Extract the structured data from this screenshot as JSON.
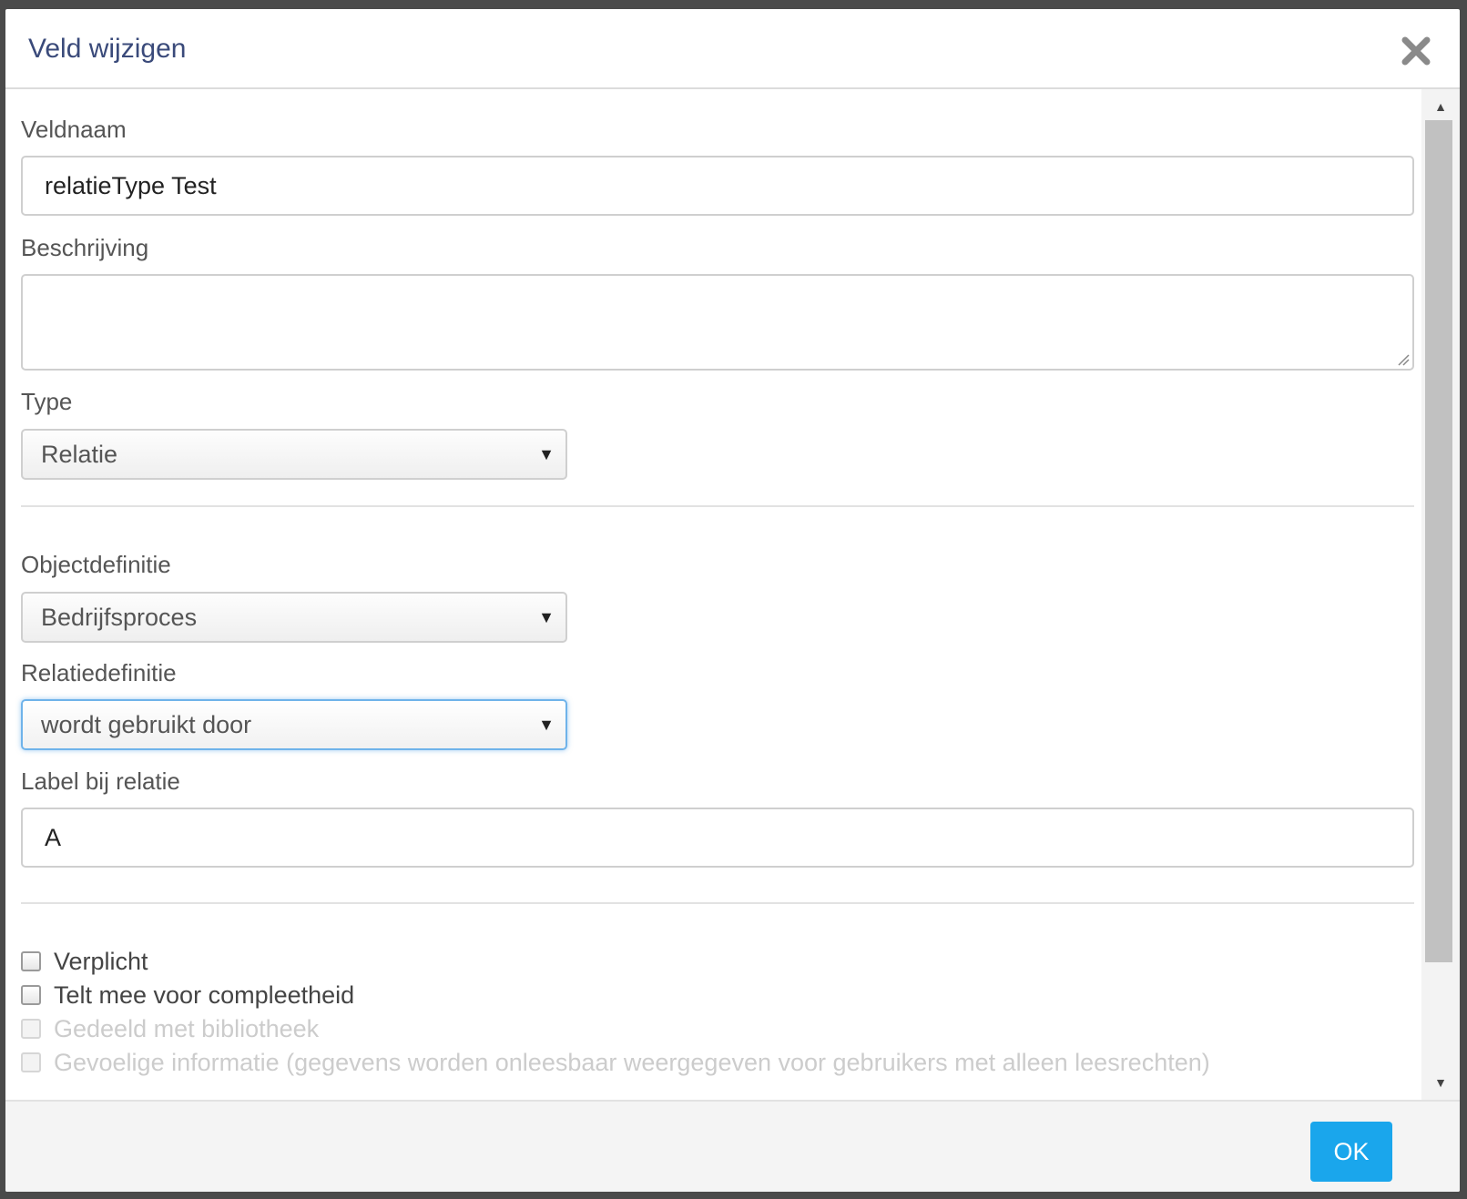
{
  "dialog": {
    "title": "Veld wijzigen",
    "close_icon": "close-icon"
  },
  "form": {
    "veldnaam": {
      "label": "Veldnaam",
      "value": "relatieType Test"
    },
    "beschrijving": {
      "label": "Beschrijving",
      "value": ""
    },
    "type": {
      "label": "Type",
      "value": "Relatie"
    },
    "objectdefinitie": {
      "label": "Objectdefinitie",
      "value": "Bedrijfsproces"
    },
    "relatiedefinitie": {
      "label": "Relatiedefinitie",
      "value": "wordt gebruikt door"
    },
    "label_bij_relatie": {
      "label": "Label bij relatie",
      "value": "A"
    }
  },
  "checkboxes": [
    {
      "label": "Verplicht",
      "checked": false,
      "disabled": false
    },
    {
      "label": "Telt mee voor compleetheid",
      "checked": false,
      "disabled": false
    },
    {
      "label": "Gedeeld met bibliotheek",
      "checked": false,
      "disabled": true
    },
    {
      "label": "Gevoelige informatie (gegevens worden onleesbaar weergegeven voor gebruikers met alleen leesrechten)",
      "checked": false,
      "disabled": true
    }
  ],
  "footer": {
    "ok_label": "OK"
  },
  "colors": {
    "title": "#3a4a7a",
    "ok_button": "#1aa6ec",
    "focus_border": "#6fb3ea"
  },
  "icons": {
    "dropdown": "caret-down-icon",
    "scroll_up": "arrow-up-icon",
    "scroll_down": "arrow-down-icon"
  }
}
